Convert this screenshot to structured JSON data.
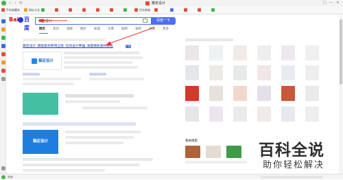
{
  "browser": {
    "tab_title": "稿定设计",
    "window_controls": [
      "□",
      "—",
      "✕"
    ]
  },
  "bookmarks": [
    {
      "label": "手机收藏夹",
      "color": "#e94b35"
    },
    {
      "label": "网址大全",
      "color": "#f0a020"
    },
    {
      "label": "",
      "color": "#3cb84a"
    },
    {
      "label": "",
      "color": "#e94b35"
    },
    {
      "label": "",
      "color": "#e94b35"
    },
    {
      "label": "",
      "color": "#e94b35"
    },
    {
      "label": "",
      "color": "#e94b35"
    },
    {
      "label": "",
      "color": "#e94b35"
    },
    {
      "label": "",
      "color": "#3cb84a"
    },
    {
      "label": "京东商城",
      "color": "#e94b35"
    },
    {
      "label": "",
      "color": "#e94b35"
    },
    {
      "label": "",
      "color": "#4e6ef2"
    },
    {
      "label": "",
      "color": "#e94b35"
    },
    {
      "label": "",
      "color": "#e94b35"
    },
    {
      "label": "",
      "color": "#3cb84a"
    }
  ],
  "search": {
    "logo_left": "Bai",
    "logo_right": "百度",
    "query": "稿定设计",
    "button_label": "百度一下"
  },
  "tabs": [
    "网页",
    "资讯",
    "视频",
    "图片",
    "知道",
    "文库",
    "贴吧",
    "采购",
    "地图",
    "更多"
  ],
  "result1": {
    "title": "稿定设计_模版素材商用正版_在线设计神器_海量模板素材模板",
    "ad_badge": "广告",
    "logo_text": "稿定设计"
  },
  "blue_card_text": "稿定设计",
  "related_title": "相关搜索",
  "watermark": {
    "title": "百科全说",
    "subtitle": "助你轻松解决"
  },
  "status_text": "完成",
  "colors": {
    "accent": "#4e6ef2",
    "link": "#2440b3",
    "arrow": "#e53935"
  }
}
